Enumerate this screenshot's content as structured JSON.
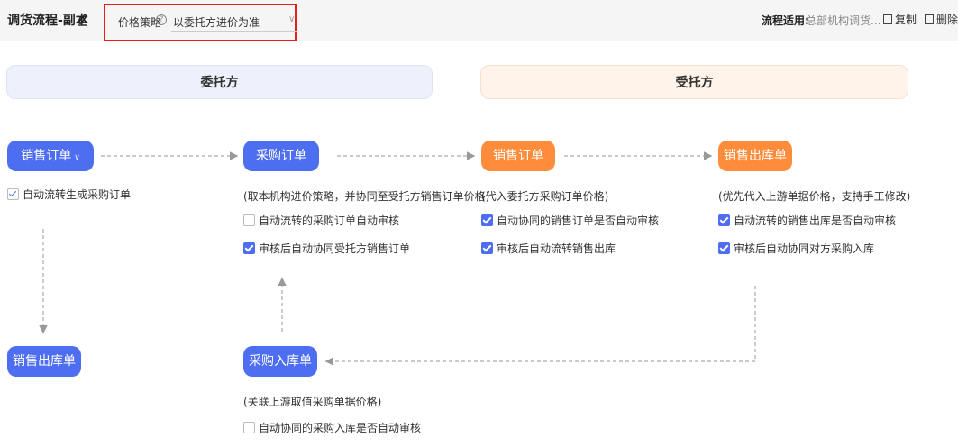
{
  "header": {
    "title": "调货流程-副本",
    "price_label": "价格策略",
    "price_value": "以委托方进价为准",
    "scope_label": "流程适用:",
    "scope_value": "总部机构调货...",
    "copy_label": "复制",
    "delete_label": "删除"
  },
  "sections": {
    "left": "委托方",
    "right": "受托方"
  },
  "nodes": {
    "sales_order_left": {
      "label": "销售订单",
      "color": "#4e6ef2"
    },
    "purchase_order": {
      "label": "采购订单",
      "color": "#4e6ef2"
    },
    "sales_order_right": {
      "label": "销售订单",
      "color": "#ff8c3a"
    },
    "sales_outbound_right": {
      "label": "销售出库单",
      "color": "#ff8c3a"
    },
    "sales_outbound_left": {
      "label": "销售出库单",
      "color": "#4e6ef2"
    },
    "purchase_inbound": {
      "label": "采购入库单",
      "color": "#4e6ef2"
    }
  },
  "options": {
    "sales_order_left": [
      {
        "label": "自动流转生成采购订单",
        "checked": true,
        "disabled": true
      }
    ],
    "purchase_order": {
      "hint": "(取本机构进价策略，并协同至受托方销售订单价格)",
      "items": [
        {
          "label": "自动流转的采购订单自动审核",
          "checked": false
        },
        {
          "label": "审核后自动协同受托方销售订单",
          "checked": true
        }
      ]
    },
    "sales_order_right": {
      "hint": "(代入委托方采购订单价格)",
      "items": [
        {
          "label": "自动协同的销售订单是否自动审核",
          "checked": true
        },
        {
          "label": "审核后自动流转销售出库",
          "checked": true
        }
      ]
    },
    "sales_outbound_right": {
      "hint": "(优先代入上游单据价格，支持手工修改)",
      "items": [
        {
          "label": "自动流转的销售出库是否自动审核",
          "checked": true
        },
        {
          "label": "审核后自动协同对方采购入库",
          "checked": true
        }
      ]
    },
    "purchase_inbound": {
      "hint": "(关联上游取值采购单据价格)",
      "items": [
        {
          "label": "自动协同的采购入库是否自动审核",
          "checked": false
        }
      ]
    }
  },
  "icons": {
    "edit": "pencil-icon",
    "help": "question-circle-icon",
    "dropdown": "chevron-down-icon",
    "copy": "copy-icon",
    "delete": "trash-icon",
    "node_caret": "chevron-down-icon"
  }
}
